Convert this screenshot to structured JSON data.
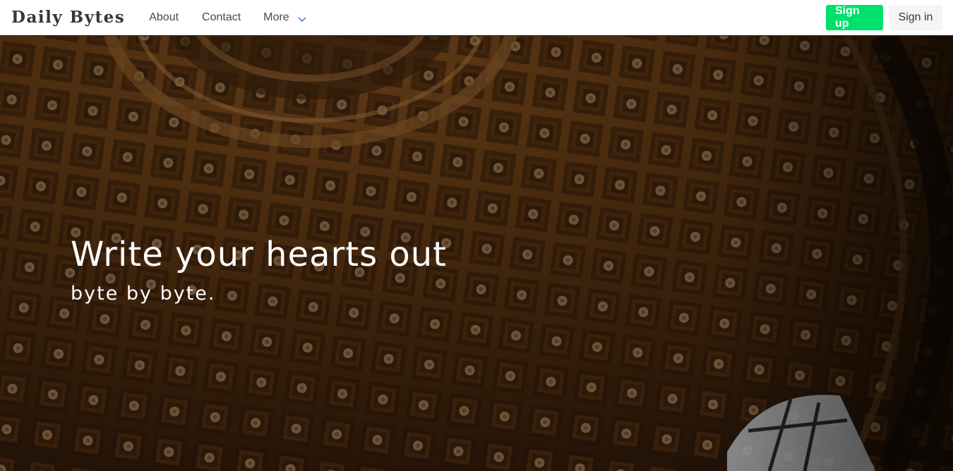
{
  "navbar": {
    "brand": "Daily Bytes",
    "links": {
      "about": "About",
      "contact": "Contact",
      "more": "More"
    },
    "buttons": {
      "signup": "Sign up",
      "signin": "Sign in"
    }
  },
  "hero": {
    "title": "Write your hearts out",
    "subtitle": "byte by byte."
  },
  "colors": {
    "signup_button": "#00e16b",
    "signin_button": "#f5f5f5",
    "navbar_background": "#ffffff",
    "hero_tint": "#3a2410"
  },
  "icons": {
    "more_dropdown": "chevron-down-icon"
  }
}
